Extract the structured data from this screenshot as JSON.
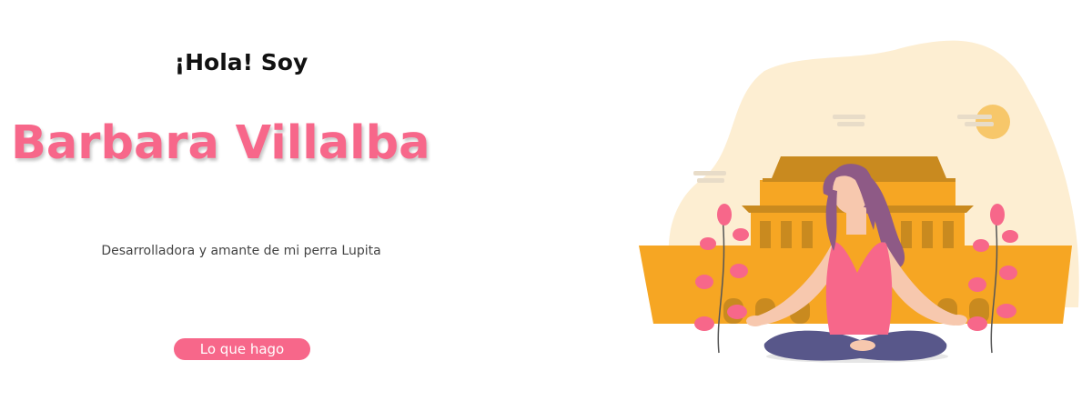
{
  "hero": {
    "greeting": "¡Hola! Soy",
    "name": "Barbara Villalba",
    "tagline": "Desarrolladora y amante de mi perra Lupita",
    "cta_label": "Lo que hago"
  },
  "illustration": {
    "description_icon": "woman-meditating-temple-illustration",
    "colors": {
      "accent": "#f7678a",
      "blob": "#fdeed2",
      "temple": "#f6a623",
      "temple_dark": "#c98a1f",
      "hair": "#8e5a86",
      "pants": "#58578a",
      "skin": "#f7c8ae",
      "sun": "#f7c76a"
    }
  }
}
